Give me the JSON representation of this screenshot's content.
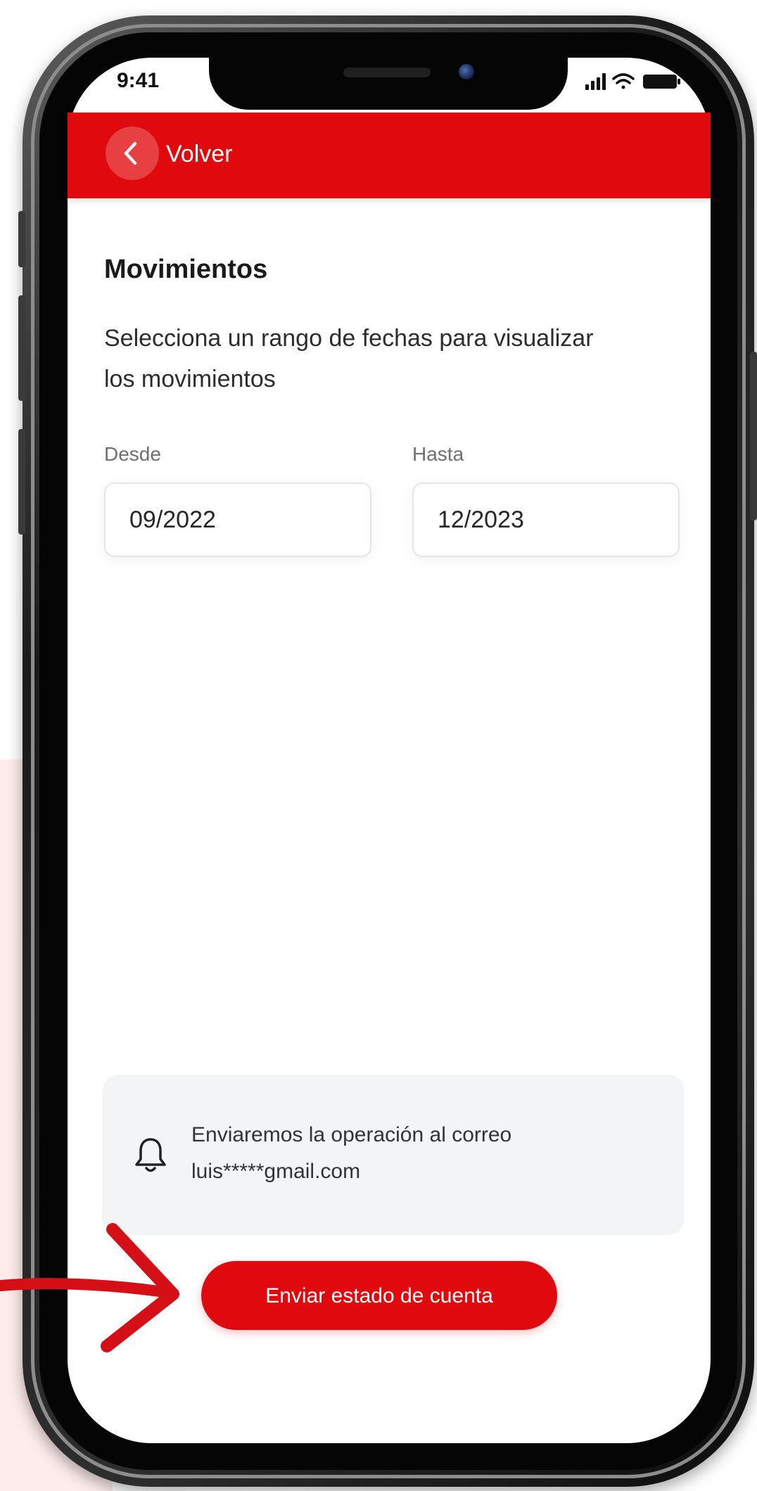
{
  "status_bar": {
    "time": "9:41",
    "signal_icon": "signal-bars-icon",
    "wifi_icon": "wifi-icon",
    "battery_icon": "battery-icon"
  },
  "header": {
    "back_icon": "chevron-left-icon",
    "back_label": "Volver"
  },
  "main": {
    "title": "Movimientos",
    "subtitle": "Selecciona un rango de fechas para visualizar los movimientos",
    "from_label": "Desde",
    "from_value": "09/2022",
    "to_label": "Hasta",
    "to_value": "12/2023"
  },
  "notice": {
    "icon": "bell-icon",
    "text_line1": "Enviaremos la operación al correo",
    "text_line2": "luis*****gmail.com"
  },
  "actions": {
    "send_label": "Enviar estado de cuenta"
  },
  "colors": {
    "brand_red": "#e0090e",
    "notice_bg": "#f3f4f6"
  },
  "annotation": {
    "arrow_icon": "hand-drawn-arrow-icon"
  }
}
